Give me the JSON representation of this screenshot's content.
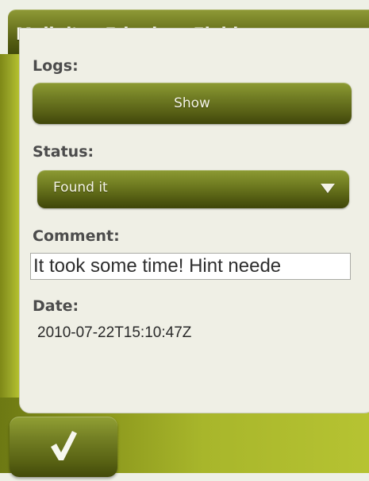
{
  "header": {
    "title": "Moli d'en Frigola > Field notes"
  },
  "logs": {
    "label": "Logs:",
    "button_label": "Show"
  },
  "status": {
    "label": "Status:",
    "selected_value": "Found it"
  },
  "comment": {
    "label": "Comment:",
    "value": "It took some time! Hint neede"
  },
  "date": {
    "label": "Date:",
    "value": "2010-07-22T15:10:47Z"
  },
  "footer": {
    "confirm_icon": "check-icon"
  }
}
